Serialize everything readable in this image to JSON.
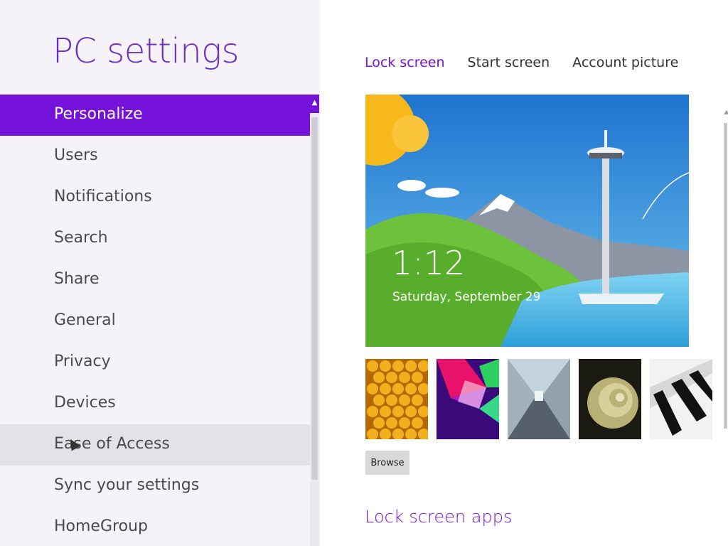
{
  "app": {
    "title": "PC settings"
  },
  "nav": {
    "items": [
      {
        "label": "Personalize",
        "state": "selected"
      },
      {
        "label": "Users",
        "state": "normal"
      },
      {
        "label": "Notifications",
        "state": "normal"
      },
      {
        "label": "Search",
        "state": "normal"
      },
      {
        "label": "Share",
        "state": "normal"
      },
      {
        "label": "General",
        "state": "normal"
      },
      {
        "label": "Privacy",
        "state": "normal"
      },
      {
        "label": "Devices",
        "state": "normal"
      },
      {
        "label": "Ease of Access",
        "state": "hovered"
      },
      {
        "label": "Sync your settings",
        "state": "normal"
      },
      {
        "label": "HomeGroup",
        "state": "normal"
      }
    ]
  },
  "tabs": [
    {
      "label": "Lock screen",
      "active": true
    },
    {
      "label": "Start screen",
      "active": false
    },
    {
      "label": "Account picture",
      "active": false
    }
  ],
  "preview": {
    "time": "1:12",
    "date": "Saturday, September 29"
  },
  "thumbnails": [
    {
      "name": "honeycomb"
    },
    {
      "name": "geometric-shapes"
    },
    {
      "name": "tunnel"
    },
    {
      "name": "nautilus-shell"
    },
    {
      "name": "piano-keys"
    }
  ],
  "browse": {
    "label": "Browse"
  },
  "lock_screen_apps": {
    "title": "Lock screen apps"
  },
  "colors": {
    "accent": "#7512d9",
    "nav_background": "#f5f3f7"
  }
}
